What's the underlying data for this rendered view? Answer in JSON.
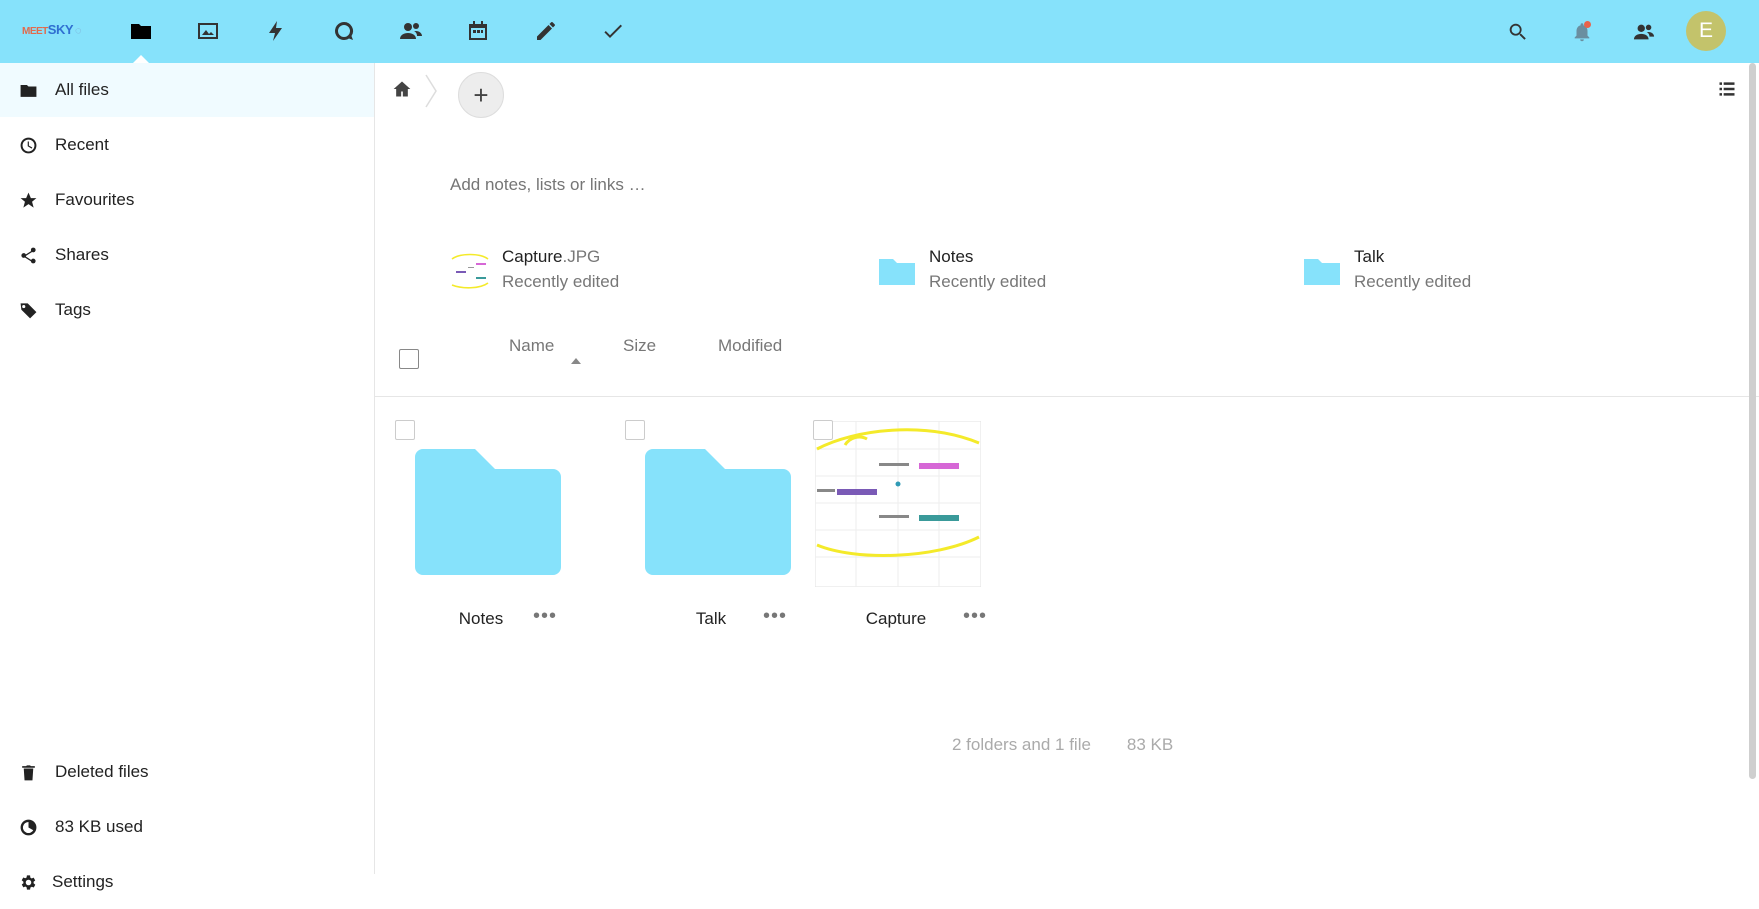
{
  "brand": {
    "logo_part1": "MEET",
    "logo_part2": "SKY",
    "logo_part3": "ꟷ"
  },
  "topbar": {
    "apps": [
      "files-icon",
      "photos-icon",
      "activity-icon",
      "talk-icon",
      "contacts-icon",
      "calendar-icon",
      "notes-icon",
      "tasks-icon"
    ],
    "avatar_initial": "E",
    "colors": {
      "bar": "#86e2fb",
      "avatar": "#c3c36b"
    }
  },
  "sidebar": {
    "items": [
      {
        "label": "All files",
        "icon": "folder-icon"
      },
      {
        "label": "Recent",
        "icon": "clock-icon"
      },
      {
        "label": "Favourites",
        "icon": "star-icon"
      },
      {
        "label": "Shares",
        "icon": "share-icon"
      },
      {
        "label": "Tags",
        "icon": "tag-icon"
      }
    ],
    "deleted_label": "Deleted files",
    "quota_label": "83 KB used",
    "settings_label": "Settings"
  },
  "main": {
    "notes_placeholder": "Add notes, lists or links …",
    "recent": [
      {
        "name": "Capture",
        "ext": ".JPG",
        "sub": "Recently edited"
      },
      {
        "name": "Notes",
        "ext": "",
        "sub": "Recently edited"
      },
      {
        "name": "Talk",
        "ext": "",
        "sub": "Recently edited"
      }
    ],
    "columns": {
      "name": "Name",
      "size": "Size",
      "modified": "Modified"
    },
    "files": [
      {
        "name": "Notes",
        "type": "folder"
      },
      {
        "name": "Talk",
        "type": "folder"
      },
      {
        "name": "Capture",
        "type": "image"
      }
    ],
    "summary": {
      "count": "2 folders and 1 file",
      "size": "83 KB"
    }
  }
}
